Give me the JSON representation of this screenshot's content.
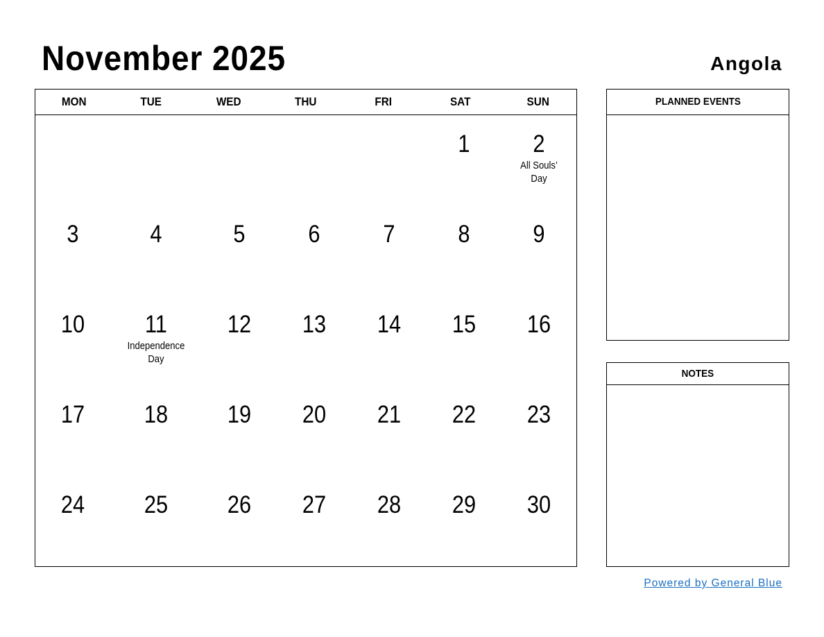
{
  "header": {
    "month_title": "November 2025",
    "country": "Angola"
  },
  "calendar": {
    "weekdays": [
      "MON",
      "TUE",
      "WED",
      "THU",
      "FRI",
      "SAT",
      "SUN"
    ],
    "cells": [
      {
        "day": "",
        "holiday": ""
      },
      {
        "day": "",
        "holiday": ""
      },
      {
        "day": "",
        "holiday": ""
      },
      {
        "day": "",
        "holiday": ""
      },
      {
        "day": "",
        "holiday": ""
      },
      {
        "day": "1",
        "holiday": ""
      },
      {
        "day": "2",
        "holiday": "All Souls’ Day"
      },
      {
        "day": "3",
        "holiday": ""
      },
      {
        "day": "4",
        "holiday": ""
      },
      {
        "day": "5",
        "holiday": ""
      },
      {
        "day": "6",
        "holiday": ""
      },
      {
        "day": "7",
        "holiday": ""
      },
      {
        "day": "8",
        "holiday": ""
      },
      {
        "day": "9",
        "holiday": ""
      },
      {
        "day": "10",
        "holiday": ""
      },
      {
        "day": "11",
        "holiday": "Independence Day"
      },
      {
        "day": "12",
        "holiday": ""
      },
      {
        "day": "13",
        "holiday": ""
      },
      {
        "day": "14",
        "holiday": ""
      },
      {
        "day": "15",
        "holiday": ""
      },
      {
        "day": "16",
        "holiday": ""
      },
      {
        "day": "17",
        "holiday": ""
      },
      {
        "day": "18",
        "holiday": ""
      },
      {
        "day": "19",
        "holiday": ""
      },
      {
        "day": "20",
        "holiday": ""
      },
      {
        "day": "21",
        "holiday": ""
      },
      {
        "day": "22",
        "holiday": ""
      },
      {
        "day": "23",
        "holiday": ""
      },
      {
        "day": "24",
        "holiday": ""
      },
      {
        "day": "25",
        "holiday": ""
      },
      {
        "day": "26",
        "holiday": ""
      },
      {
        "day": "27",
        "holiday": ""
      },
      {
        "day": "28",
        "holiday": ""
      },
      {
        "day": "29",
        "holiday": ""
      },
      {
        "day": "30",
        "holiday": ""
      }
    ]
  },
  "panels": {
    "planned_events_label": "PLANNED EVENTS",
    "notes_label": "NOTES"
  },
  "footer": {
    "link_text": "Powered by General Blue",
    "link_color": "#1a6fc4"
  }
}
